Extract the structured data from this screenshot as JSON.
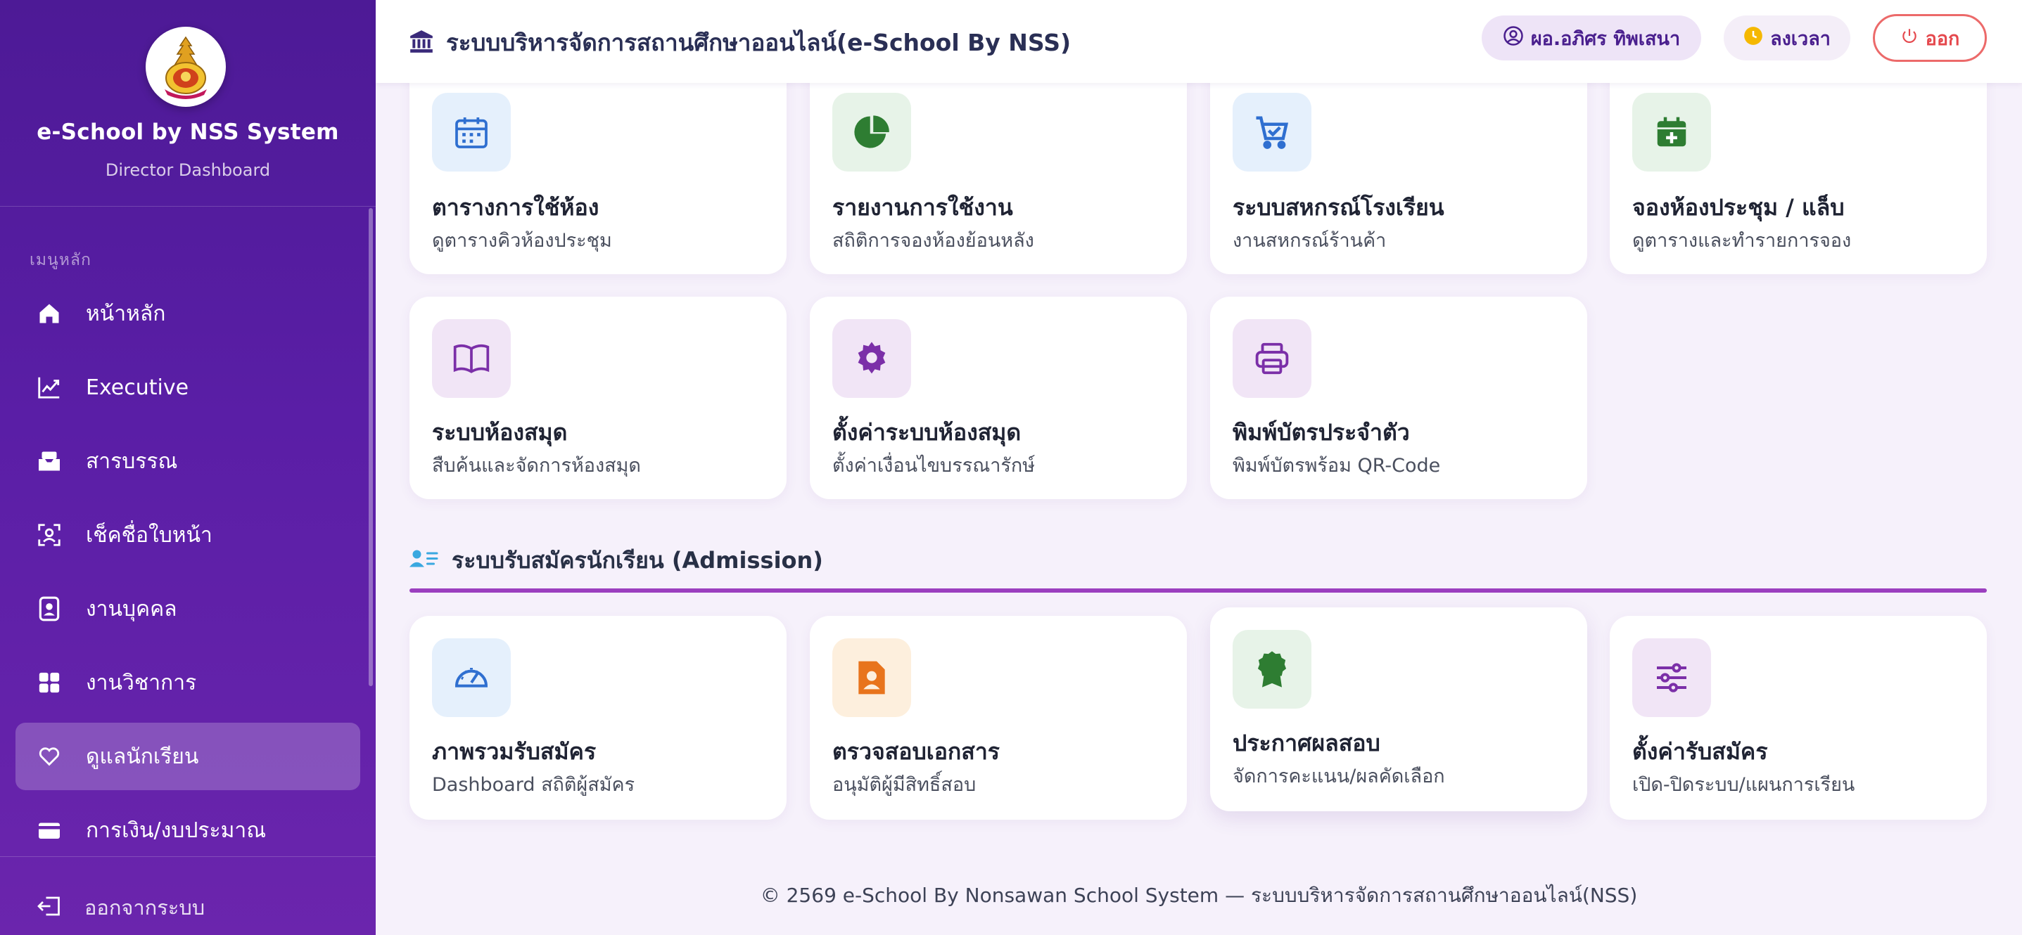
{
  "header": {
    "title": "ระบบบริหารจัดการสถานศึกษาออนไลน์(e-School By NSS)",
    "user": "ผอ.อภิศร ทิพเสนา",
    "clock_in": "ลงเวลา",
    "logout": "ออก"
  },
  "sidebar": {
    "brand_title": "e-School by NSS System",
    "brand_subtitle": "Director Dashboard",
    "menu_heading": "เมนูหลัก",
    "items": [
      {
        "label": "หน้าหลัก",
        "icon": "home-icon"
      },
      {
        "label": "Executive",
        "icon": "chart-line-icon"
      },
      {
        "label": "สารบรรณ",
        "icon": "inbox-icon"
      },
      {
        "label": "เช็คชื่อใบหน้า",
        "icon": "face-scan-icon"
      },
      {
        "label": "งานบุคคล",
        "icon": "id-badge-icon"
      },
      {
        "label": "งานวิชาการ",
        "icon": "grid-icon"
      },
      {
        "label": "ดูแลนักเรียน",
        "icon": "heart-icon",
        "active": true
      },
      {
        "label": "การเงิน/งบประมาณ",
        "icon": "wallet-icon"
      }
    ],
    "logout_label": "ออกจากระบบ"
  },
  "cards_row1": [
    {
      "title": "ตารางการใช้ห้อง",
      "subtitle": "ดูตารางคิวห้องประชุม",
      "icon": "calendar-icon",
      "color": "#2f6fd0"
    },
    {
      "title": "รายงานการใช้งาน",
      "subtitle": "สถิติการจองห้องย้อนหลัง",
      "icon": "pie-chart-icon",
      "color": "#2e7d32"
    },
    {
      "title": "ระบบสหกรณ์โรงเรียน",
      "subtitle": "งานสหกรณ์ร้านค้า",
      "icon": "cart-icon",
      "color": "#2f6fd0"
    },
    {
      "title": "จองห้องประชุม / แล็บ",
      "subtitle": "ดูตารางและทำรายการจอง",
      "icon": "calendar-plus-icon",
      "color": "#2e7d32"
    }
  ],
  "cards_row2": [
    {
      "title": "ระบบห้องสมุด",
      "subtitle": "สืบค้นและจัดการห้องสมุด",
      "icon": "book-icon",
      "color": "#7b2fa8"
    },
    {
      "title": "ตั้งค่าระบบห้องสมุด",
      "subtitle": "ตั้งค่าเงื่อนไขบรรณารักษ์",
      "icon": "gear-icon",
      "color": "#7b2fa8"
    },
    {
      "title": "พิมพ์บัตรประจำตัว",
      "subtitle": "พิมพ์บัตรพร้อม QR-Code",
      "icon": "printer-icon",
      "color": "#7b2fa8"
    }
  ],
  "admission": {
    "heading": "ระบบรับสมัครนักเรียน (Admission)",
    "cards": [
      {
        "title": "ภาพรวมรับสมัคร",
        "subtitle": "Dashboard สถิติผู้สมัคร",
        "icon": "speedometer-icon",
        "color": "#2f6fd0"
      },
      {
        "title": "ตรวจสอบเอกสาร",
        "subtitle": "อนุมัติผู้มีสิทธิ์สอบ",
        "icon": "document-person-icon",
        "color": "#e8741c"
      },
      {
        "title": "ประกาศผลสอบ",
        "subtitle": "จัดการคะแนน/ผลคัดเลือก",
        "icon": "award-icon",
        "color": "#2e7d32"
      },
      {
        "title": "ตั้งค่ารับสมัคร",
        "subtitle": "เปิด-ปิดระบบ/แผนการเรียน",
        "icon": "sliders-icon",
        "color": "#7b2fa8"
      }
    ]
  },
  "footer": "© 2569 e-School By Nonsawan School System — ระบบบริหารจัดการสถานศึกษาออนไลน์(NSS)"
}
